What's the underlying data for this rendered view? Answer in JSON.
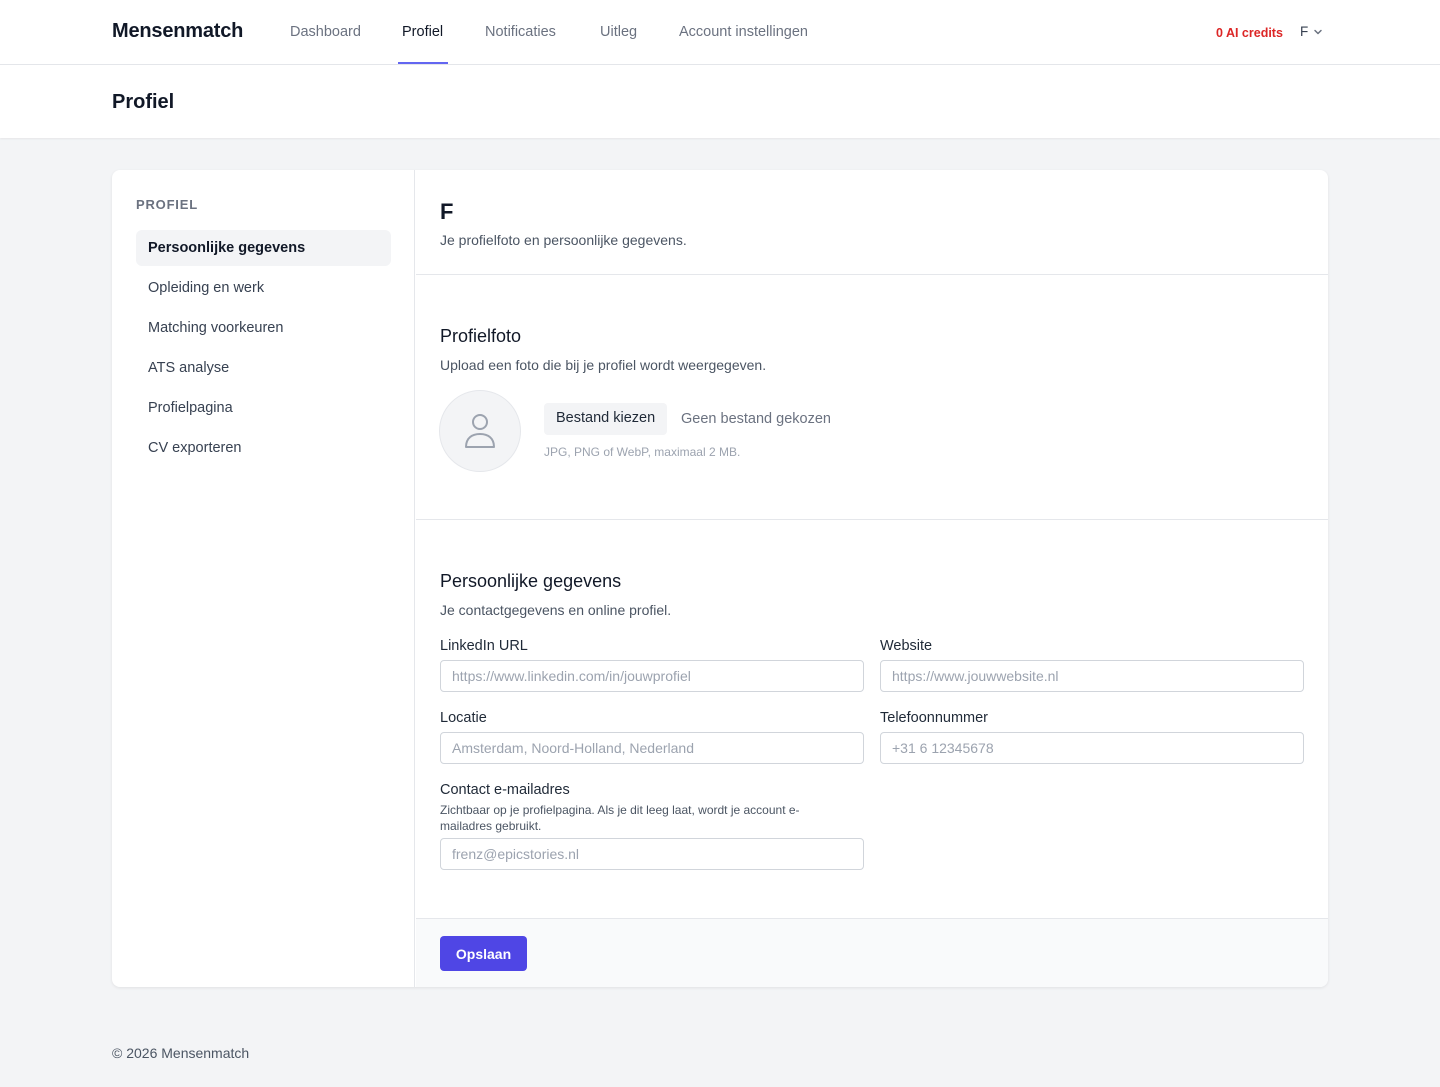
{
  "nav": {
    "brand": "Mensenmatch",
    "links": [
      "Dashboard",
      "Profiel",
      "Notificaties",
      "Uitleg",
      "Account instellingen"
    ],
    "credits": "0 AI credits",
    "user_initial": "F"
  },
  "page": {
    "title": "Profiel"
  },
  "sidebar": {
    "heading": "PROFIEL",
    "items": [
      "Persoonlijke gegevens",
      "Opleiding en werk",
      "Matching voorkeuren",
      "ATS analyse",
      "Profielpagina",
      "CV exporteren"
    ]
  },
  "main": {
    "name": "F",
    "subtitle": "Je profielfoto en persoonlijke gegevens.",
    "photo": {
      "title": "Profielfoto",
      "subtitle": "Upload een foto die bij je profiel wordt weergegeven.",
      "button": "Bestand kiezen",
      "no_file": "Geen bestand gekozen",
      "hint": "JPG, PNG of WebP, maximaal 2 MB."
    },
    "personal": {
      "title": "Persoonlijke gegevens",
      "subtitle": "Je contactgegevens en online profiel.",
      "linkedin_label": "LinkedIn URL",
      "linkedin_placeholder": "https://www.linkedin.com/in/jouwprofiel",
      "website_label": "Website",
      "website_placeholder": "https://www.jouwwebsite.nl",
      "location_label": "Locatie",
      "location_placeholder": "Amsterdam, Noord-Holland, Nederland",
      "phone_label": "Telefoonnummer",
      "phone_placeholder": "+31 6 12345678",
      "email_label": "Contact e-mailadres",
      "email_hint": "Zichtbaar op je profielpagina. Als je dit leeg laat, wordt je account e-mailadres gebruikt.",
      "email_placeholder": "frenz@epicstories.nl"
    },
    "save_label": "Opslaan"
  },
  "footer": {
    "copyright": "© 2026 Mensenmatch"
  },
  "colors": {
    "accent": "#4f46e5",
    "credits": "#dc2626",
    "nav_underline": "#6366f1"
  }
}
